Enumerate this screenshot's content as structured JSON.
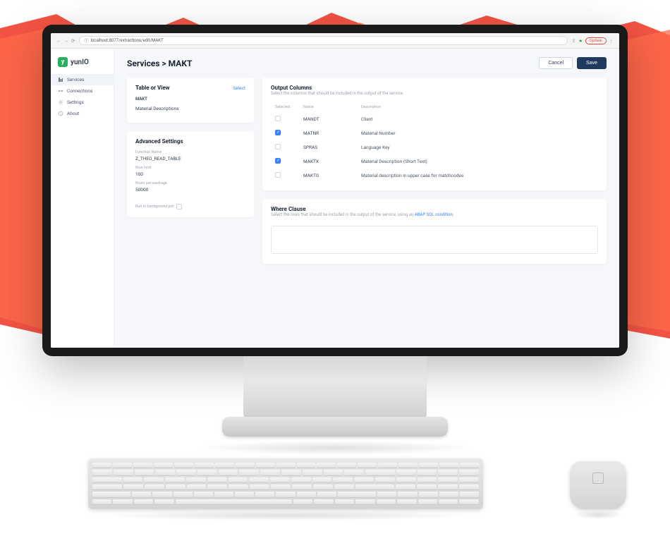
{
  "browser": {
    "url": "localhost:8077/extractions/edit/MAKT",
    "update_label": "Update"
  },
  "brand": {
    "glyph": "y",
    "name": "yunIO"
  },
  "sidebar": {
    "items": [
      {
        "label": "Services",
        "icon": "services-icon",
        "active": true
      },
      {
        "label": "Connections",
        "icon": "connections-icon",
        "active": false
      },
      {
        "label": "Settings",
        "icon": "settings-icon",
        "active": false
      },
      {
        "label": "About",
        "icon": "about-icon",
        "active": false
      }
    ]
  },
  "header": {
    "breadcrumb": "Services > MAKT",
    "cancel_label": "Cancel",
    "save_label": "Save"
  },
  "table_view": {
    "title": "Table or View",
    "select_label": "Select",
    "name": "MAKT",
    "description": "Material Descriptions"
  },
  "advanced": {
    "title": "Advanced Settings",
    "function_label": "Function Name",
    "function_value": "Z_THEO_READ_TABLE",
    "row_limit_label": "Row limit",
    "row_limit_value": "100",
    "rows_pkg_label": "Rows per package",
    "rows_pkg_value": "50000",
    "bg_job_label": "Run in background job"
  },
  "output_columns": {
    "title": "Output Columns",
    "subtitle": "Select the columns that should be included in the output of the service.",
    "headers": {
      "selected": "Selected",
      "name": "Name",
      "description": "Description"
    },
    "rows": [
      {
        "selected": false,
        "name": "MANDT",
        "description": "Client"
      },
      {
        "selected": true,
        "name": "MATNR",
        "description": "Material Number"
      },
      {
        "selected": false,
        "name": "SPRAS",
        "description": "Language Key"
      },
      {
        "selected": true,
        "name": "MAKTX",
        "description": "Material Description (Short Text)"
      },
      {
        "selected": false,
        "name": "MAKTG",
        "description": "Material description in upper case for matchcodes"
      }
    ]
  },
  "where": {
    "title": "Where Clause",
    "subtitle_prefix": "Select the rows that should be included in the output of the service, using an ",
    "subtitle_link": "ABAP SQL condition",
    "subtitle_suffix": "."
  }
}
